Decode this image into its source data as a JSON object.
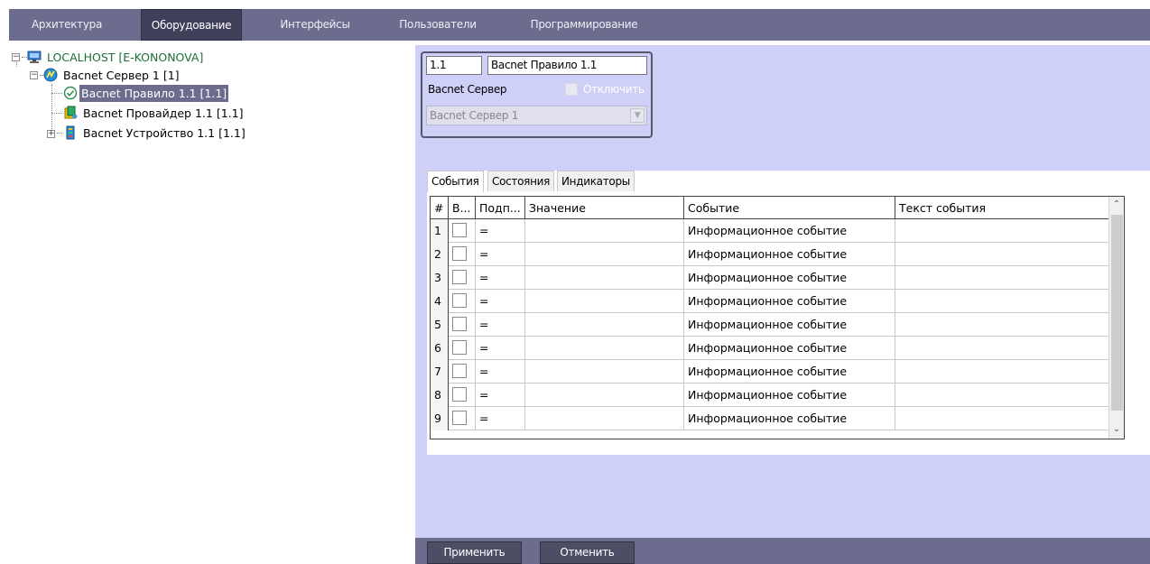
{
  "top_tabs": [
    {
      "label": "Архитектура"
    },
    {
      "label": "Оборудование"
    },
    {
      "label": "Интерфейсы"
    },
    {
      "label": "Пользователи"
    },
    {
      "label": "Программирование"
    }
  ],
  "tree": {
    "root": "LOCALHOST [E-KONONOVA]",
    "server": "Bacnet Сервер 1 [1]",
    "rule": "Bacnet Правило 1.1 [1.1]",
    "provider": "Bacnet Провайдер 1.1 [1.1]",
    "device": "Bacnet Устройство 1.1 [1.1]",
    "expand_symbol": "+",
    "collapse_symbol": "−"
  },
  "props": {
    "id_value": "1.1",
    "name_value": "Bacnet Правило 1.1",
    "server_label": "Bacnet Сервер",
    "disable_label": "Отключить",
    "server_select": "Bacnet Сервер 1"
  },
  "grid_tabs": [
    {
      "label": "События"
    },
    {
      "label": "Состояния"
    },
    {
      "label": "Индикаторы"
    }
  ],
  "grid": {
    "headers": [
      "#",
      "В...",
      "Подп...",
      "Значение",
      "Событие",
      "Текст события"
    ],
    "rows": [
      {
        "n": "1",
        "sub": "=",
        "event": "Информационное событие"
      },
      {
        "n": "2",
        "sub": "=",
        "event": "Информационное событие"
      },
      {
        "n": "3",
        "sub": "=",
        "event": "Информационное событие"
      },
      {
        "n": "4",
        "sub": "=",
        "event": "Информационное событие"
      },
      {
        "n": "5",
        "sub": "=",
        "event": "Информационное событие"
      },
      {
        "n": "6",
        "sub": "=",
        "event": "Информационное событие"
      },
      {
        "n": "7",
        "sub": "=",
        "event": "Информационное событие"
      },
      {
        "n": "8",
        "sub": "=",
        "event": "Информационное событие"
      },
      {
        "n": "9",
        "sub": "=",
        "event": "Информационное событие"
      }
    ]
  },
  "buttons": {
    "apply": "Применить",
    "cancel": "Отменить"
  },
  "colors": {
    "accent": "#6b6c8e",
    "panel": "#cfd0f7",
    "tree_root_text": "#1c6e3a"
  }
}
